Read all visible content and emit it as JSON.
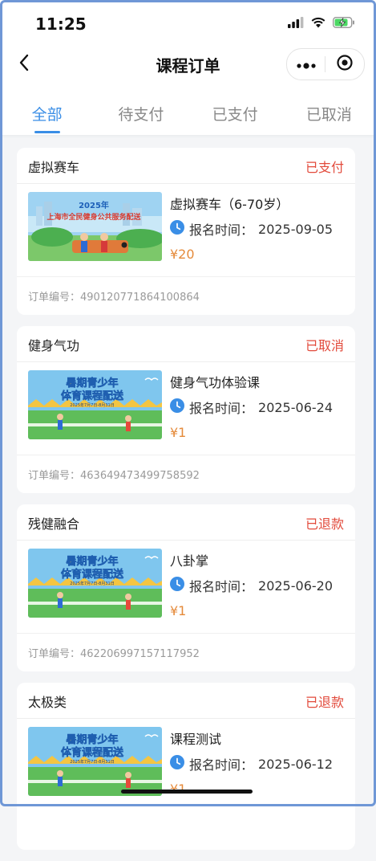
{
  "status_bar": {
    "time": "11:25"
  },
  "nav": {
    "title": "课程订单"
  },
  "tabs": [
    {
      "label": "全部",
      "active": true
    },
    {
      "label": "待支付",
      "active": false
    },
    {
      "label": "已支付",
      "active": false
    },
    {
      "label": "已取消",
      "active": false
    }
  ],
  "orders": [
    {
      "category": "虚拟赛车",
      "status": "已支付",
      "course": "虚拟赛车（6-70岁）",
      "reg_label": "报名时间：",
      "reg_date": "2025-09-05",
      "price": "¥20",
      "order_label": "订单编号：",
      "order_no": "490120771864100864",
      "banner": {
        "title": "2025年",
        "subtitle": "上海市全民健身公共服务配送"
      }
    },
    {
      "category": "健身气功",
      "status": "已取消",
      "course": "健身气功体验课",
      "reg_label": "报名时间：",
      "reg_date": "2025-06-24",
      "price": "¥1",
      "order_label": "订单编号：",
      "order_no": "463649473499758592",
      "banner": {
        "title": "暑期青少年",
        "subtitle": "体育课程配送",
        "date_line": "2025年7月7日-8月31日"
      }
    },
    {
      "category": "残健融合",
      "status": "已退款",
      "course": "八卦掌",
      "reg_label": "报名时间：",
      "reg_date": "2025-06-20",
      "price": "¥1",
      "order_label": "订单编号：",
      "order_no": "462206997157117952",
      "banner": {
        "title": "暑期青少年",
        "subtitle": "体育课程配送",
        "date_line": "2025年7月7日-8月31日"
      }
    },
    {
      "category": "太极类",
      "status": "已退款",
      "course": "课程测试",
      "reg_label": "报名时间：",
      "reg_date": "2025-06-12",
      "price": "¥1",
      "banner": {
        "title": "暑期青少年",
        "subtitle": "体育课程配送",
        "date_line": "2025年7月7日-8月31日"
      }
    }
  ],
  "colors": {
    "accent": "#3a8ee6",
    "status_red": "#e24a3b",
    "price_orange": "#e58a3a"
  }
}
